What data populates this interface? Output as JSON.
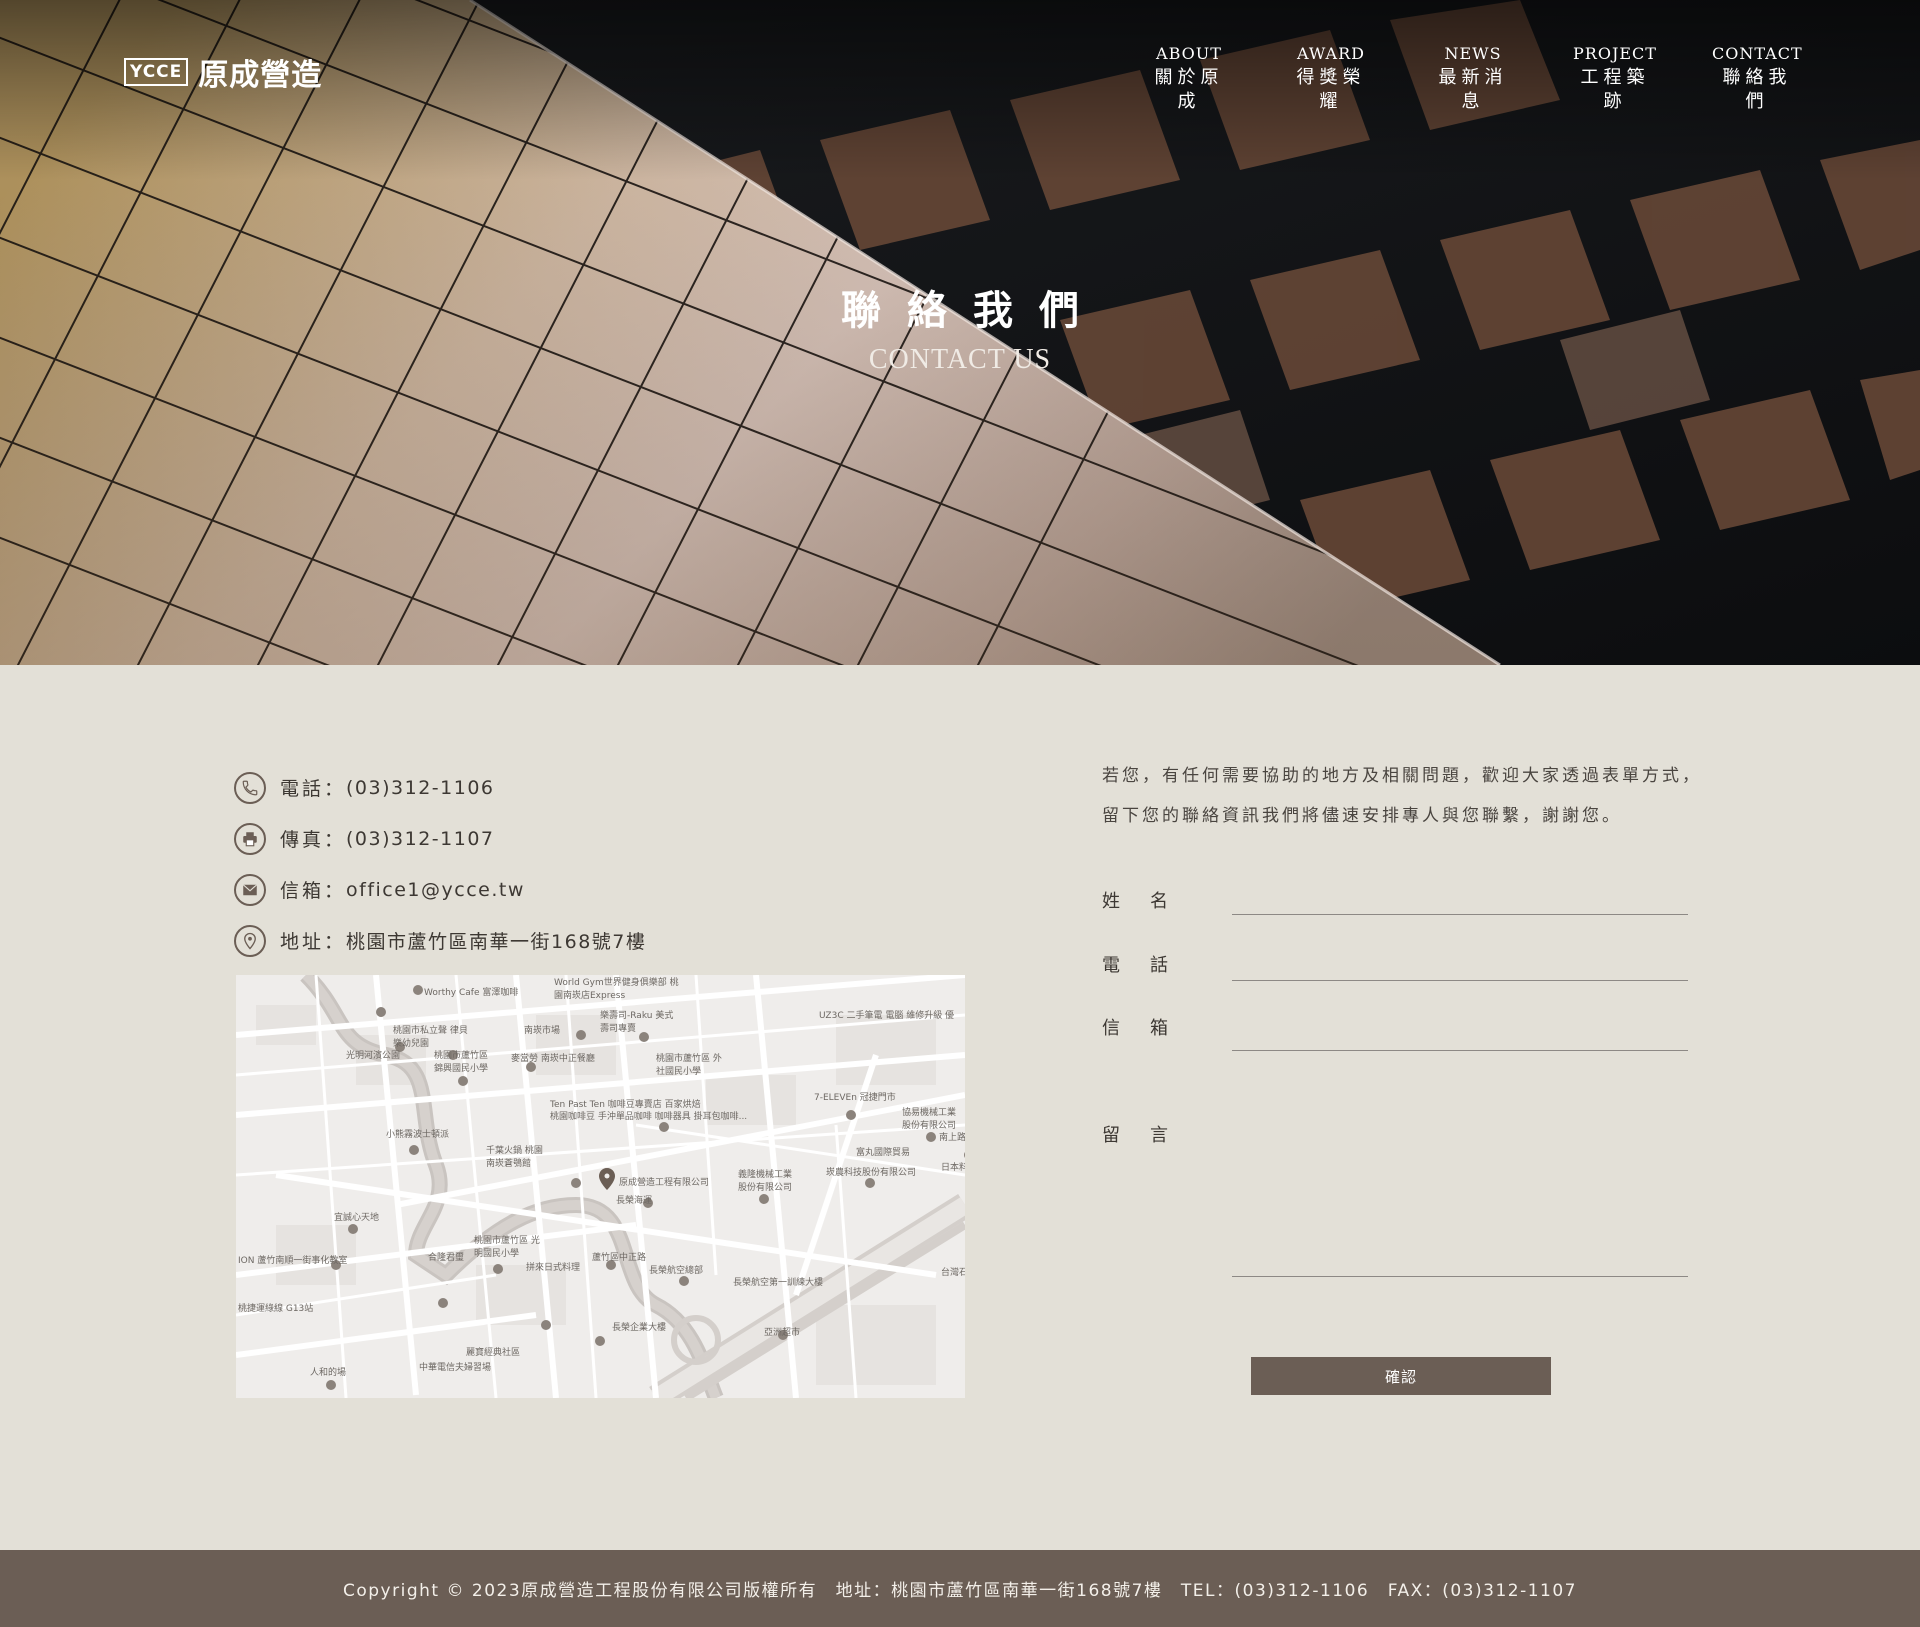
{
  "header": {
    "logo_mark": "YCCE",
    "logo_text": "原成營造",
    "nav": [
      {
        "en": "ABOUT",
        "zh": "關於原成"
      },
      {
        "en": "AWARD",
        "zh": "得獎榮耀"
      },
      {
        "en": "NEWS",
        "zh": "最新消息"
      },
      {
        "en": "PROJECT",
        "zh": "工程築跡"
      },
      {
        "en": "CONTACT",
        "zh": "聯絡我們"
      }
    ]
  },
  "hero": {
    "title": "聯絡我們",
    "subtitle": "CONTACT US"
  },
  "contact": {
    "phone": {
      "label": "電話：",
      "value": "(03)312-1106",
      "icon": "phone-icon"
    },
    "fax": {
      "label": "傳真：",
      "value": "(03)312-1107",
      "icon": "printer-icon"
    },
    "email": {
      "label": "信箱：",
      "value": "office1@ycce.tw",
      "icon": "mail-icon"
    },
    "address": {
      "label": "地址：",
      "value": "桃園市蘆竹區南華一街168號7樓",
      "icon": "location-pin-icon"
    }
  },
  "map": {
    "labels": [
      "Worthy Cafe 富澤咖啡",
      "World Gym世界健身俱樂部 桃園南崁店Express",
      "樂壽司-Raku 美式壽司專賣",
      "UZ3C 二手筆電 電腦 維修升級 優",
      "桃園市私立聲 律貝樂幼兒園",
      "南崁市場",
      "光明河濱公園",
      "桃園市蘆竹區 錦興國民小學",
      "麥當勞 南崁中正餐廳",
      "桃園市蘆竹區 外社國民小學",
      "Ten Past Ten 咖啡豆專賣店 百家烘焙",
      "桃園咖啡豆 手沖單品咖啡 咖啡器具 掛耳包咖啡...",
      "7-ELEVEn 冠捷門市",
      "協易機械工業 股份有限公司",
      "小熊霧波士頓派",
      "千葉火鍋 桃園 南崁蒼鴞館",
      "原成營造工程有限公司",
      "義隆機械工業 股份有限公司",
      "崁農科技股份有限公司",
      "富丸國際貿易",
      "長榮海運",
      "宜誠心天地",
      "桃園市蘆竹區 光明國民小學",
      "合隆君璽",
      "拼來日式料理",
      "蘆竹區中正路",
      "長榮航空總部",
      "長榮航空第一訓練大樓",
      "長榮企業大樓",
      "亞洲超市",
      "麗寶經典社區",
      "中華電信夫婦習場",
      "人和的場",
      "ION 蘆竹南順一街事化教室",
      "桃捷運綠線 G13站",
      "日本料",
      "台灣石",
      "南上路"
    ]
  },
  "form": {
    "intro_line1": "若您，有任何需要協助的地方及相關問題，歡迎大家透過表單方式，",
    "intro_line2": "留下您的聯絡資訊我們將儘速安排專人與您聯繫，謝謝您。",
    "fields": [
      {
        "label": "姓名"
      },
      {
        "label": "電話"
      },
      {
        "label": "信箱"
      },
      {
        "label": "留言"
      }
    ],
    "submit_label": "確認"
  },
  "footer": {
    "text": "Copyright © 2023原成營造工程股份有限公司版權所有　地址：桃園市蘆竹區南華一街168號7樓　TEL：(03)312-1106　FAX：(03)312-1107"
  },
  "colors": {
    "page_bg": "#e3e0d7",
    "accent": "#6b5e55",
    "footer_bg": "#6b5e55",
    "text": "#3d3833"
  }
}
